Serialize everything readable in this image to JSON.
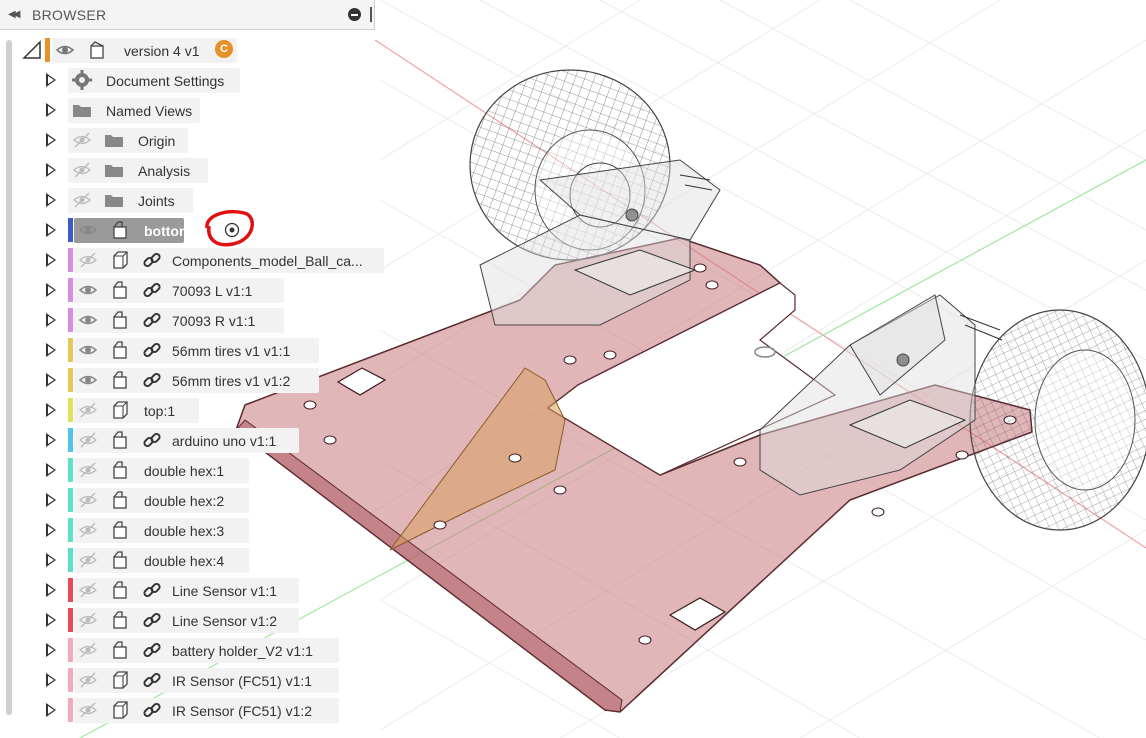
{
  "browser": {
    "title": "BROWSER",
    "root": {
      "label": "version 4 v1",
      "badge_text": "C"
    },
    "items": [
      {
        "label": "Document Settings",
        "type": "settings-icon",
        "visible": null,
        "link": false,
        "color": null
      },
      {
        "label": "Named Views",
        "type": "folder-icon",
        "visible": null,
        "link": false,
        "color": null
      },
      {
        "label": "Origin",
        "type": "folder-icon",
        "visible": false,
        "link": false,
        "color": null
      },
      {
        "label": "Analysis",
        "type": "folder-icon",
        "visible": false,
        "link": false,
        "color": null
      },
      {
        "label": "Joints",
        "type": "folder-icon",
        "visible": false,
        "link": false,
        "color": null
      },
      {
        "label": "bottom:1",
        "type": "component-icon",
        "visible": true,
        "link": false,
        "color": "#3b5bc6",
        "selected": true
      },
      {
        "label": "Components_model_Ball_ca...",
        "type": "body-icon",
        "visible": false,
        "link": true,
        "color": "#d88be0"
      },
      {
        "label": "70093 L v1:1",
        "type": "component-icon",
        "visible": true,
        "link": true,
        "color": "#d88be0"
      },
      {
        "label": "70093 R  v1:1",
        "type": "component-icon",
        "visible": true,
        "link": true,
        "color": "#d88be0"
      },
      {
        "label": "56mm tires v1 v1:1",
        "type": "component-icon",
        "visible": true,
        "link": true,
        "color": "#e6c55a"
      },
      {
        "label": "56mm tires v1 v1:2",
        "type": "component-icon",
        "visible": true,
        "link": true,
        "color": "#e6c55a"
      },
      {
        "label": "top:1",
        "type": "body-icon",
        "visible": false,
        "link": false,
        "color": "#e0e060"
      },
      {
        "label": "arduino uno v1:1",
        "type": "component-icon",
        "visible": false,
        "link": true,
        "color": "#4fc3e8"
      },
      {
        "label": "double hex:1",
        "type": "component-icon",
        "visible": false,
        "link": false,
        "color": "#5fe0c8"
      },
      {
        "label": "double hex:2",
        "type": "component-icon",
        "visible": false,
        "link": false,
        "color": "#5fe0c8"
      },
      {
        "label": "double hex:3",
        "type": "component-icon",
        "visible": false,
        "link": false,
        "color": "#5fe0c8"
      },
      {
        "label": "double hex:4",
        "type": "component-icon",
        "visible": false,
        "link": false,
        "color": "#5fe0c8"
      },
      {
        "label": "Line Sensor v1:1",
        "type": "component-icon",
        "visible": false,
        "link": true,
        "color": "#e84a5a"
      },
      {
        "label": "Line Sensor v1:2",
        "type": "component-icon",
        "visible": false,
        "link": true,
        "color": "#e84a5a"
      },
      {
        "label": "battery holder_V2 v1:1",
        "type": "component-icon",
        "visible": false,
        "link": true,
        "color": "#f2a8b8"
      },
      {
        "label": "IR Sensor (FC51) v1:1",
        "type": "body-icon",
        "visible": false,
        "link": true,
        "color": "#f2a8b8"
      },
      {
        "label": "IR Sensor (FC51) v1:2",
        "type": "body-icon",
        "visible": false,
        "link": true,
        "color": "#f2a8b8"
      }
    ]
  },
  "colors": {
    "accent_orange": "#e8902a",
    "annotation_red": "#e01010",
    "model_fill": "#c0606a"
  }
}
